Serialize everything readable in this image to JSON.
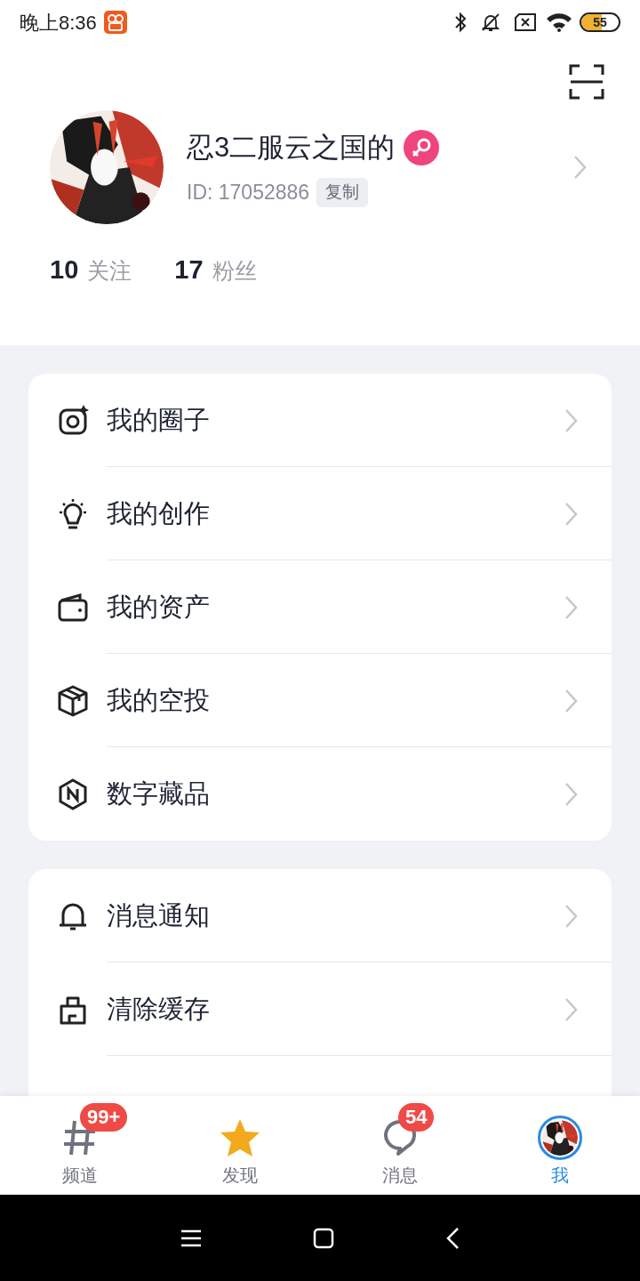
{
  "status_bar": {
    "time": "晚上8:36",
    "battery": "55"
  },
  "profile": {
    "name": "忍3二服云之国的",
    "id": "ID: 17052886",
    "copy_button": "复制",
    "stats": [
      {
        "count": "10",
        "label": "关注"
      },
      {
        "count": "17",
        "label": "粉丝"
      }
    ]
  },
  "menu_groups": [
    [
      {
        "label": "我的圈子"
      },
      {
        "label": "我的创作"
      },
      {
        "label": "我的资产"
      },
      {
        "label": "我的空投"
      },
      {
        "label": "数字藏品"
      }
    ],
    [
      {
        "label": "消息通知"
      },
      {
        "label": "清除缓存"
      }
    ]
  ],
  "tabs": [
    {
      "label": "频道",
      "badge": "99+",
      "selected": false
    },
    {
      "label": "发现",
      "selected": false
    },
    {
      "label": "消息",
      "badge": "54",
      "selected": false
    },
    {
      "label": "我",
      "selected": true
    }
  ]
}
